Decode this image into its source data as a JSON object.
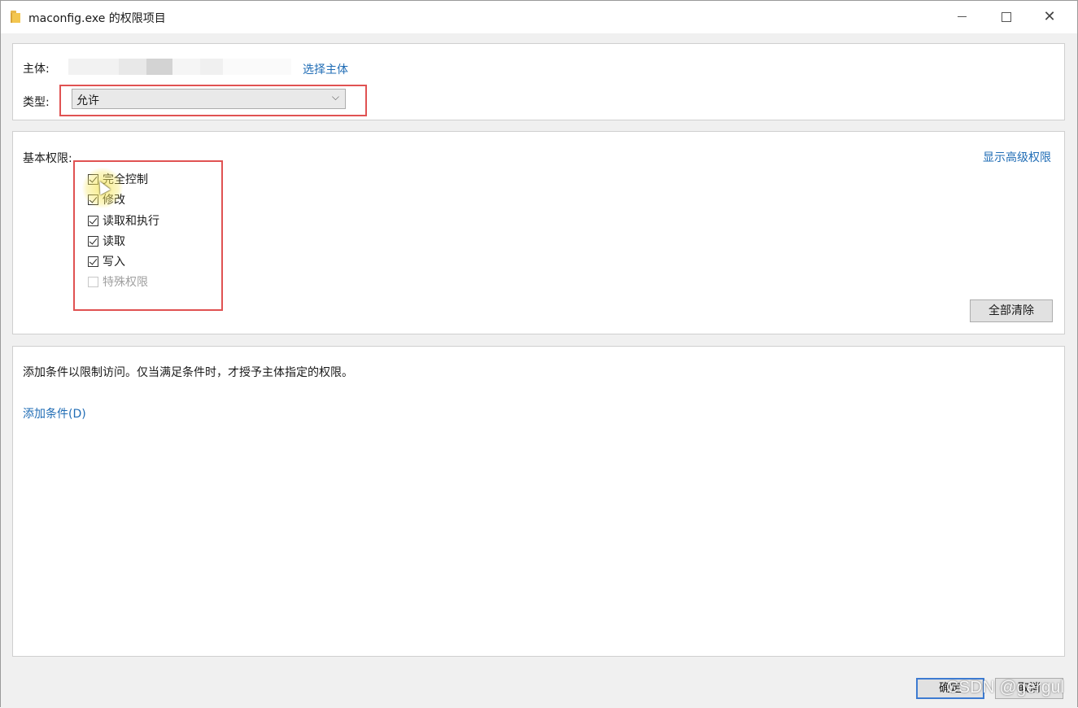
{
  "window": {
    "title": "maconfig.exe 的权限项目"
  },
  "principal": {
    "label": "主体:",
    "select_link": "选择主体"
  },
  "type": {
    "label": "类型:",
    "value": "允许"
  },
  "permissions": {
    "label": "基本权限:",
    "show_advanced_link": "显示高级权限",
    "items": [
      {
        "label": "完全控制",
        "checked": true,
        "enabled": true
      },
      {
        "label": "修改",
        "checked": true,
        "enabled": true
      },
      {
        "label": "读取和执行",
        "checked": true,
        "enabled": true
      },
      {
        "label": "读取",
        "checked": true,
        "enabled": true
      },
      {
        "label": "写入",
        "checked": true,
        "enabled": true
      },
      {
        "label": "特殊权限",
        "checked": false,
        "enabled": false
      }
    ],
    "clear_all_button": "全部清除"
  },
  "conditions": {
    "description": "添加条件以限制访问。仅当满足条件时，才授予主体指定的权限。",
    "add_link": "添加条件(D)"
  },
  "footer": {
    "ok_button": "确定",
    "cancel_button": "取消"
  },
  "watermark": "CSDN @gergul",
  "colors": {
    "link": "#1f6cb5",
    "highlight_box": "#e05252",
    "default_button_border": "#3d7bd1"
  }
}
